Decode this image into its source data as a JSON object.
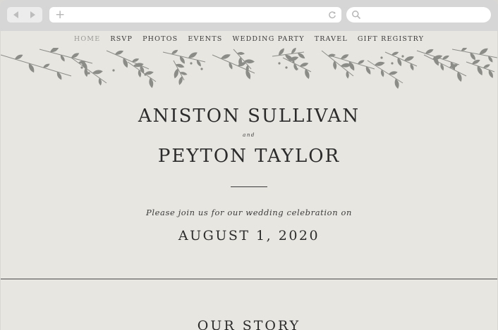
{
  "browser": {
    "url": "",
    "search_placeholder": ""
  },
  "nav": {
    "items": [
      "HOME",
      "RSVP",
      "PHOTOS",
      "EVENTS",
      "WEDDING PARTY",
      "TRAVEL",
      "GIFT REGISTRY"
    ],
    "active_index": 0
  },
  "hero": {
    "name1": "ANISTON SULLIVAN",
    "and": "and",
    "name2": "PEYTON TAYLOR",
    "invite_text": "Please join us for our wedding celebration on",
    "date": "AUGUST 1, 2020"
  },
  "sections": {
    "story_title": "OUR STORY"
  },
  "colors": {
    "page_background": "#e8e6e1",
    "text": "#2b2b2b",
    "foliage": "#8b8c88",
    "nav_active": "#9a9a96"
  },
  "icons": {
    "back": "chevron-left-icon",
    "forward": "chevron-right-icon",
    "new_tab": "plus-icon",
    "reload": "reload-icon",
    "search": "search-icon",
    "decoration": "leaf-garland-icon"
  }
}
